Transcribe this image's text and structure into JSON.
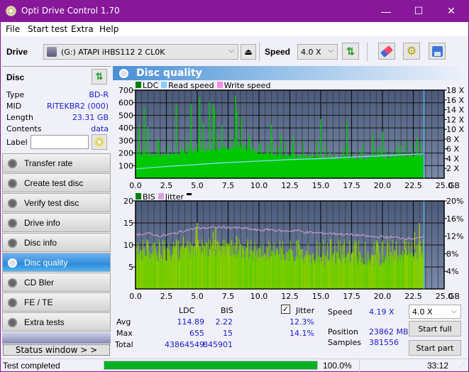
{
  "window": {
    "title": "Opti Drive Control 1.70",
    "minimize": "—",
    "maximize": "☐",
    "close": "✕"
  },
  "menu": {
    "file": "File",
    "start_test": "Start test",
    "extra": "Extra",
    "help": "Help"
  },
  "toolbar": {
    "drive_label": "Drive",
    "drive_value": "(G:)  ATAPI iHBS112   2 CL0K",
    "speed_label": "Speed",
    "speed_value": "4.0 X",
    "icons": [
      "drive-icon",
      "eject-icon",
      "refresh-icon",
      "eraser-icon",
      "settings-icon",
      "save-icon"
    ]
  },
  "disc": {
    "header": "Disc",
    "rows": [
      {
        "key": "Type",
        "value": "BD-R"
      },
      {
        "key": "MID",
        "value": "RITEKBR2 (000)"
      },
      {
        "key": "Length",
        "value": "23.31 GB"
      },
      {
        "key": "Contents",
        "value": "data"
      }
    ],
    "label_key": "Label",
    "label_value": ""
  },
  "nav": {
    "items": [
      {
        "label": "Transfer rate",
        "active": false
      },
      {
        "label": "Create test disc",
        "active": false
      },
      {
        "label": "Verify test disc",
        "active": false
      },
      {
        "label": "Drive info",
        "active": false
      },
      {
        "label": "Disc info",
        "active": false
      },
      {
        "label": "Disc quality",
        "active": true
      },
      {
        "label": "CD Bler",
        "active": false
      },
      {
        "label": "FE / TE",
        "active": false
      },
      {
        "label": "Extra tests",
        "active": false
      }
    ],
    "status_window": "Status window > >"
  },
  "panel": {
    "title": "Disc quality"
  },
  "chart_data": [
    {
      "type": "bar",
      "title": "LDC",
      "legend": [
        "LDC",
        "Read speed",
        "Write speed"
      ],
      "legend_colors": {
        "LDC": "#008000",
        "Read speed": "#87cefa",
        "Write speed": "#ff88e8"
      },
      "xlabel": "GB",
      "x_ticks": [
        "0.0",
        "2.5",
        "5.0",
        "7.5",
        "10.0",
        "12.5",
        "15.0",
        "17.5",
        "20.0",
        "22.5",
        "25.0"
      ],
      "xlim": [
        0,
        25
      ],
      "ylim": [
        0,
        700
      ],
      "y_ticks": [
        "100",
        "200",
        "300",
        "400",
        "500",
        "600",
        "700"
      ],
      "y2_ticks": [
        "2 X",
        "4 X",
        "6 X",
        "8 X",
        "10 X",
        "12 X",
        "14 X",
        "16 X",
        "18 X"
      ],
      "y2lim": [
        0,
        18
      ],
      "data_end_gb": 23.31,
      "ldc_baseline_series": {
        "x": [
          0,
          2.5,
          5,
          7.5,
          10,
          12.5,
          15,
          17.5,
          20,
          22.5,
          23.3
        ],
        "y": [
          190,
          185,
          220,
          245,
          205,
          180,
          170,
          165,
          170,
          180,
          190
        ]
      },
      "ldc_peaks": {
        "x": [
          0.3,
          0.7,
          1.0,
          1.8,
          3.3,
          4.5,
          5.2,
          5.5,
          6.0,
          6.3,
          6.4,
          7.0,
          8.1,
          8.2,
          8.6,
          9.2,
          11.0,
          11.8,
          12.8,
          14.7,
          15.0,
          17.1,
          19.2,
          20.0,
          22.8
        ],
        "y": [
          420,
          560,
          410,
          300,
          580,
          590,
          645,
          440,
          605,
          590,
          550,
          420,
          655,
          540,
          480,
          340,
          430,
          350,
          330,
          300,
          470,
          460,
          350,
          370,
          330
        ]
      },
      "read_speed_series": {
        "x": [
          0,
          2.5,
          5,
          7.5,
          10,
          12.5,
          15,
          17.5,
          20,
          22.5,
          23.3
        ],
        "y": [
          1.9,
          2.4,
          2.8,
          3.2,
          3.5,
          3.8,
          4.0,
          4.3,
          4.6,
          4.9,
          5.0
        ]
      }
    },
    {
      "type": "bar",
      "title": "BIS / Jitter",
      "legend": [
        "BIS",
        "Jitter"
      ],
      "legend_colors": {
        "BIS": "#008000",
        "Jitter": "#dda0dd"
      },
      "xlabel": "GB",
      "x_ticks": [
        "0.0",
        "2.5",
        "5.0",
        "7.5",
        "10.0",
        "12.5",
        "15.0",
        "17.5",
        "20.0",
        "22.5",
        "25.0"
      ],
      "xlim": [
        0,
        25
      ],
      "ylim": [
        0,
        20
      ],
      "y_ticks": [
        "5",
        "10",
        "15",
        "20"
      ],
      "y2_ticks": [
        "4%",
        "8%",
        "12%",
        "16%",
        "20%"
      ],
      "y2lim": [
        0,
        20
      ],
      "data_end_gb": 23.31,
      "bis_level_series": {
        "x": [
          0,
          2.5,
          5,
          7.5,
          10,
          12.5,
          15,
          17.5,
          20,
          22.5,
          23.3
        ],
        "y": [
          8,
          8,
          9,
          9,
          8,
          8,
          7,
          7,
          7,
          8,
          9
        ]
      },
      "bis_peaks": {
        "x": [
          1.0,
          3.9,
          4.9,
          5.0,
          6.3,
          6.5,
          8.2,
          21.8,
          22.6,
          23.0
        ],
        "y": [
          11,
          12,
          14,
          15,
          13,
          14,
          12,
          11,
          13,
          15
        ]
      },
      "jitter_series": {
        "x": [
          0,
          1,
          2,
          3,
          4,
          5,
          6,
          7,
          8,
          9,
          10,
          11,
          12,
          13,
          14,
          15,
          16,
          17,
          18,
          19,
          20,
          21,
          22,
          23,
          23.3
        ],
        "y": [
          12.4,
          12.6,
          12.0,
          12.5,
          13.3,
          13.8,
          13.9,
          14.0,
          13.9,
          13.7,
          13.3,
          13.5,
          13.1,
          13.3,
          12.8,
          12.7,
          12.6,
          12.4,
          12.2,
          11.9,
          11.8,
          11.7,
          11.5,
          11.5,
          11.8
        ]
      }
    }
  ],
  "stats": {
    "col_ldc": "LDC",
    "col_bis": "BIS",
    "jitter_label": "Jitter",
    "jitter_checked": true,
    "rows": [
      {
        "label": "Avg",
        "ldc": "114.89",
        "bis": "2.22",
        "jitter": "12.3%"
      },
      {
        "label": "Max",
        "ldc": "655",
        "bis": "15",
        "jitter": "14.1%"
      },
      {
        "label": "Total",
        "ldc": "43864549",
        "bis": "845901",
        "jitter": ""
      }
    ],
    "speed_label": "Speed",
    "speed_value": "4.19 X",
    "position_label": "Position",
    "position_value": "23862 MB",
    "samples_label": "Samples",
    "samples_value": "381556",
    "speed_select": "4.0 X",
    "start_full": "Start full",
    "start_part": "Start part"
  },
  "statusbar": {
    "status": "Test completed",
    "progress_percent": 100.0,
    "progress_text": "100.0%",
    "time": "33:12"
  }
}
